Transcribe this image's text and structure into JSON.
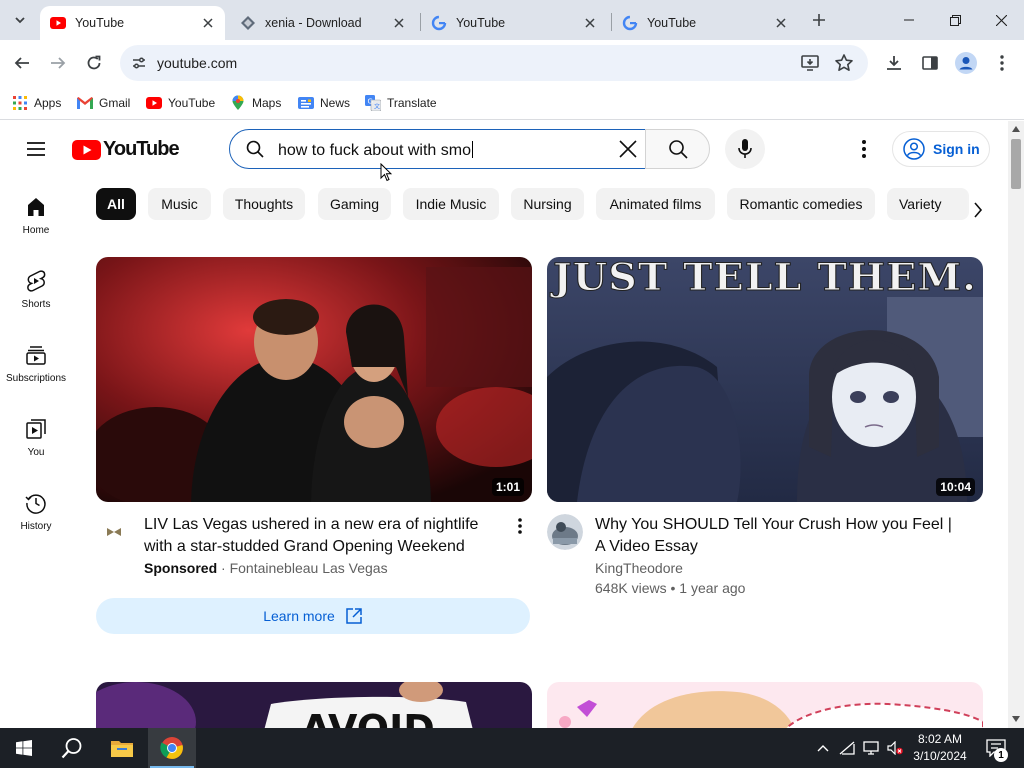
{
  "browser": {
    "tabs": [
      {
        "title": "YouTube",
        "active": true
      },
      {
        "title": "xenia - Download",
        "active": false
      },
      {
        "title": "YouTube",
        "active": false
      },
      {
        "title": "YouTube",
        "active": false
      }
    ],
    "url": "youtube.com",
    "bookmarks": [
      "Apps",
      "Gmail",
      "YouTube",
      "Maps",
      "News",
      "Translate"
    ]
  },
  "youtube": {
    "logo_text": "YouTube",
    "search": {
      "query": "how to fuck about with smo"
    },
    "sign_in": "Sign in",
    "guide": [
      "Home",
      "Shorts",
      "Subscriptions",
      "You",
      "History"
    ],
    "chips": [
      "All",
      "Music",
      "Thoughts",
      "Gaming",
      "Indie Music",
      "Nursing",
      "Animated films",
      "Romantic comedies",
      "Variety"
    ],
    "videos": [
      {
        "title": "LIV Las Vegas ushered in a new era of nightlife with a star-studded Grand Opening Weekend",
        "sponsored": "Sponsored",
        "channel": "Fontainebleau Las Vegas",
        "duration": "1:01",
        "cta": "Learn more"
      },
      {
        "title": "Why You SHOULD Tell Your Crush How you Feel | A Video Essay",
        "channel": "KingTheodore",
        "stats": "648K views • 1 year ago",
        "duration": "10:04",
        "thumb_text": "JUST TELL THEM."
      }
    ],
    "next_row_thumb_text": "AVOID"
  },
  "taskbar": {
    "time": "8:02 AM",
    "date": "3/10/2024",
    "notifications": "1"
  },
  "colors": {
    "yt_red": "#ff0000",
    "link_blue": "#065fd4",
    "tabstrip": "#dee3eb",
    "taskbar": "#1c2026"
  }
}
